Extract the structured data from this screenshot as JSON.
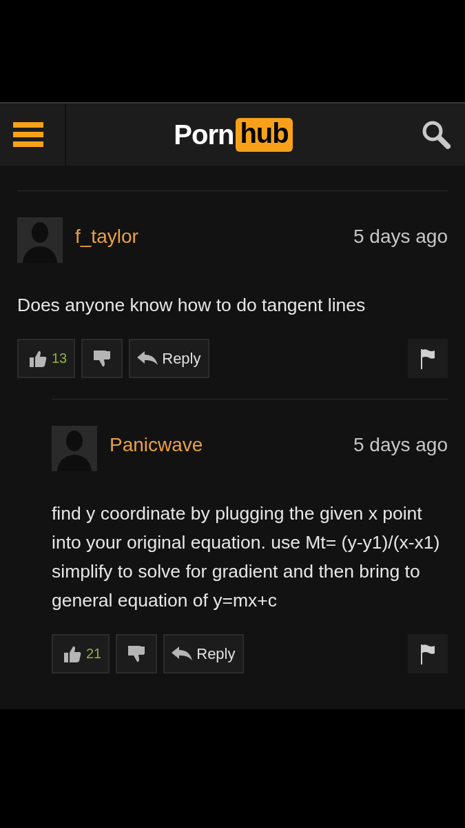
{
  "header": {
    "logo_left": "Porn",
    "logo_right": "hub"
  },
  "comments": [
    {
      "username": "f_taylor",
      "time": "5 days ago",
      "text": "Does anyone know how to do tangent lines",
      "likes": "13",
      "reply_label": "Reply",
      "children": [
        {
          "username": "Panicwave",
          "time": "5 days ago",
          "text": "find y coordinate by plugging the given x point into your original equation. use Mt= (y-y1)/(x-x1) simplify to solve for gradient and then bring to general equation of y=mx+c",
          "likes": "21",
          "reply_label": "Reply"
        }
      ]
    }
  ]
}
